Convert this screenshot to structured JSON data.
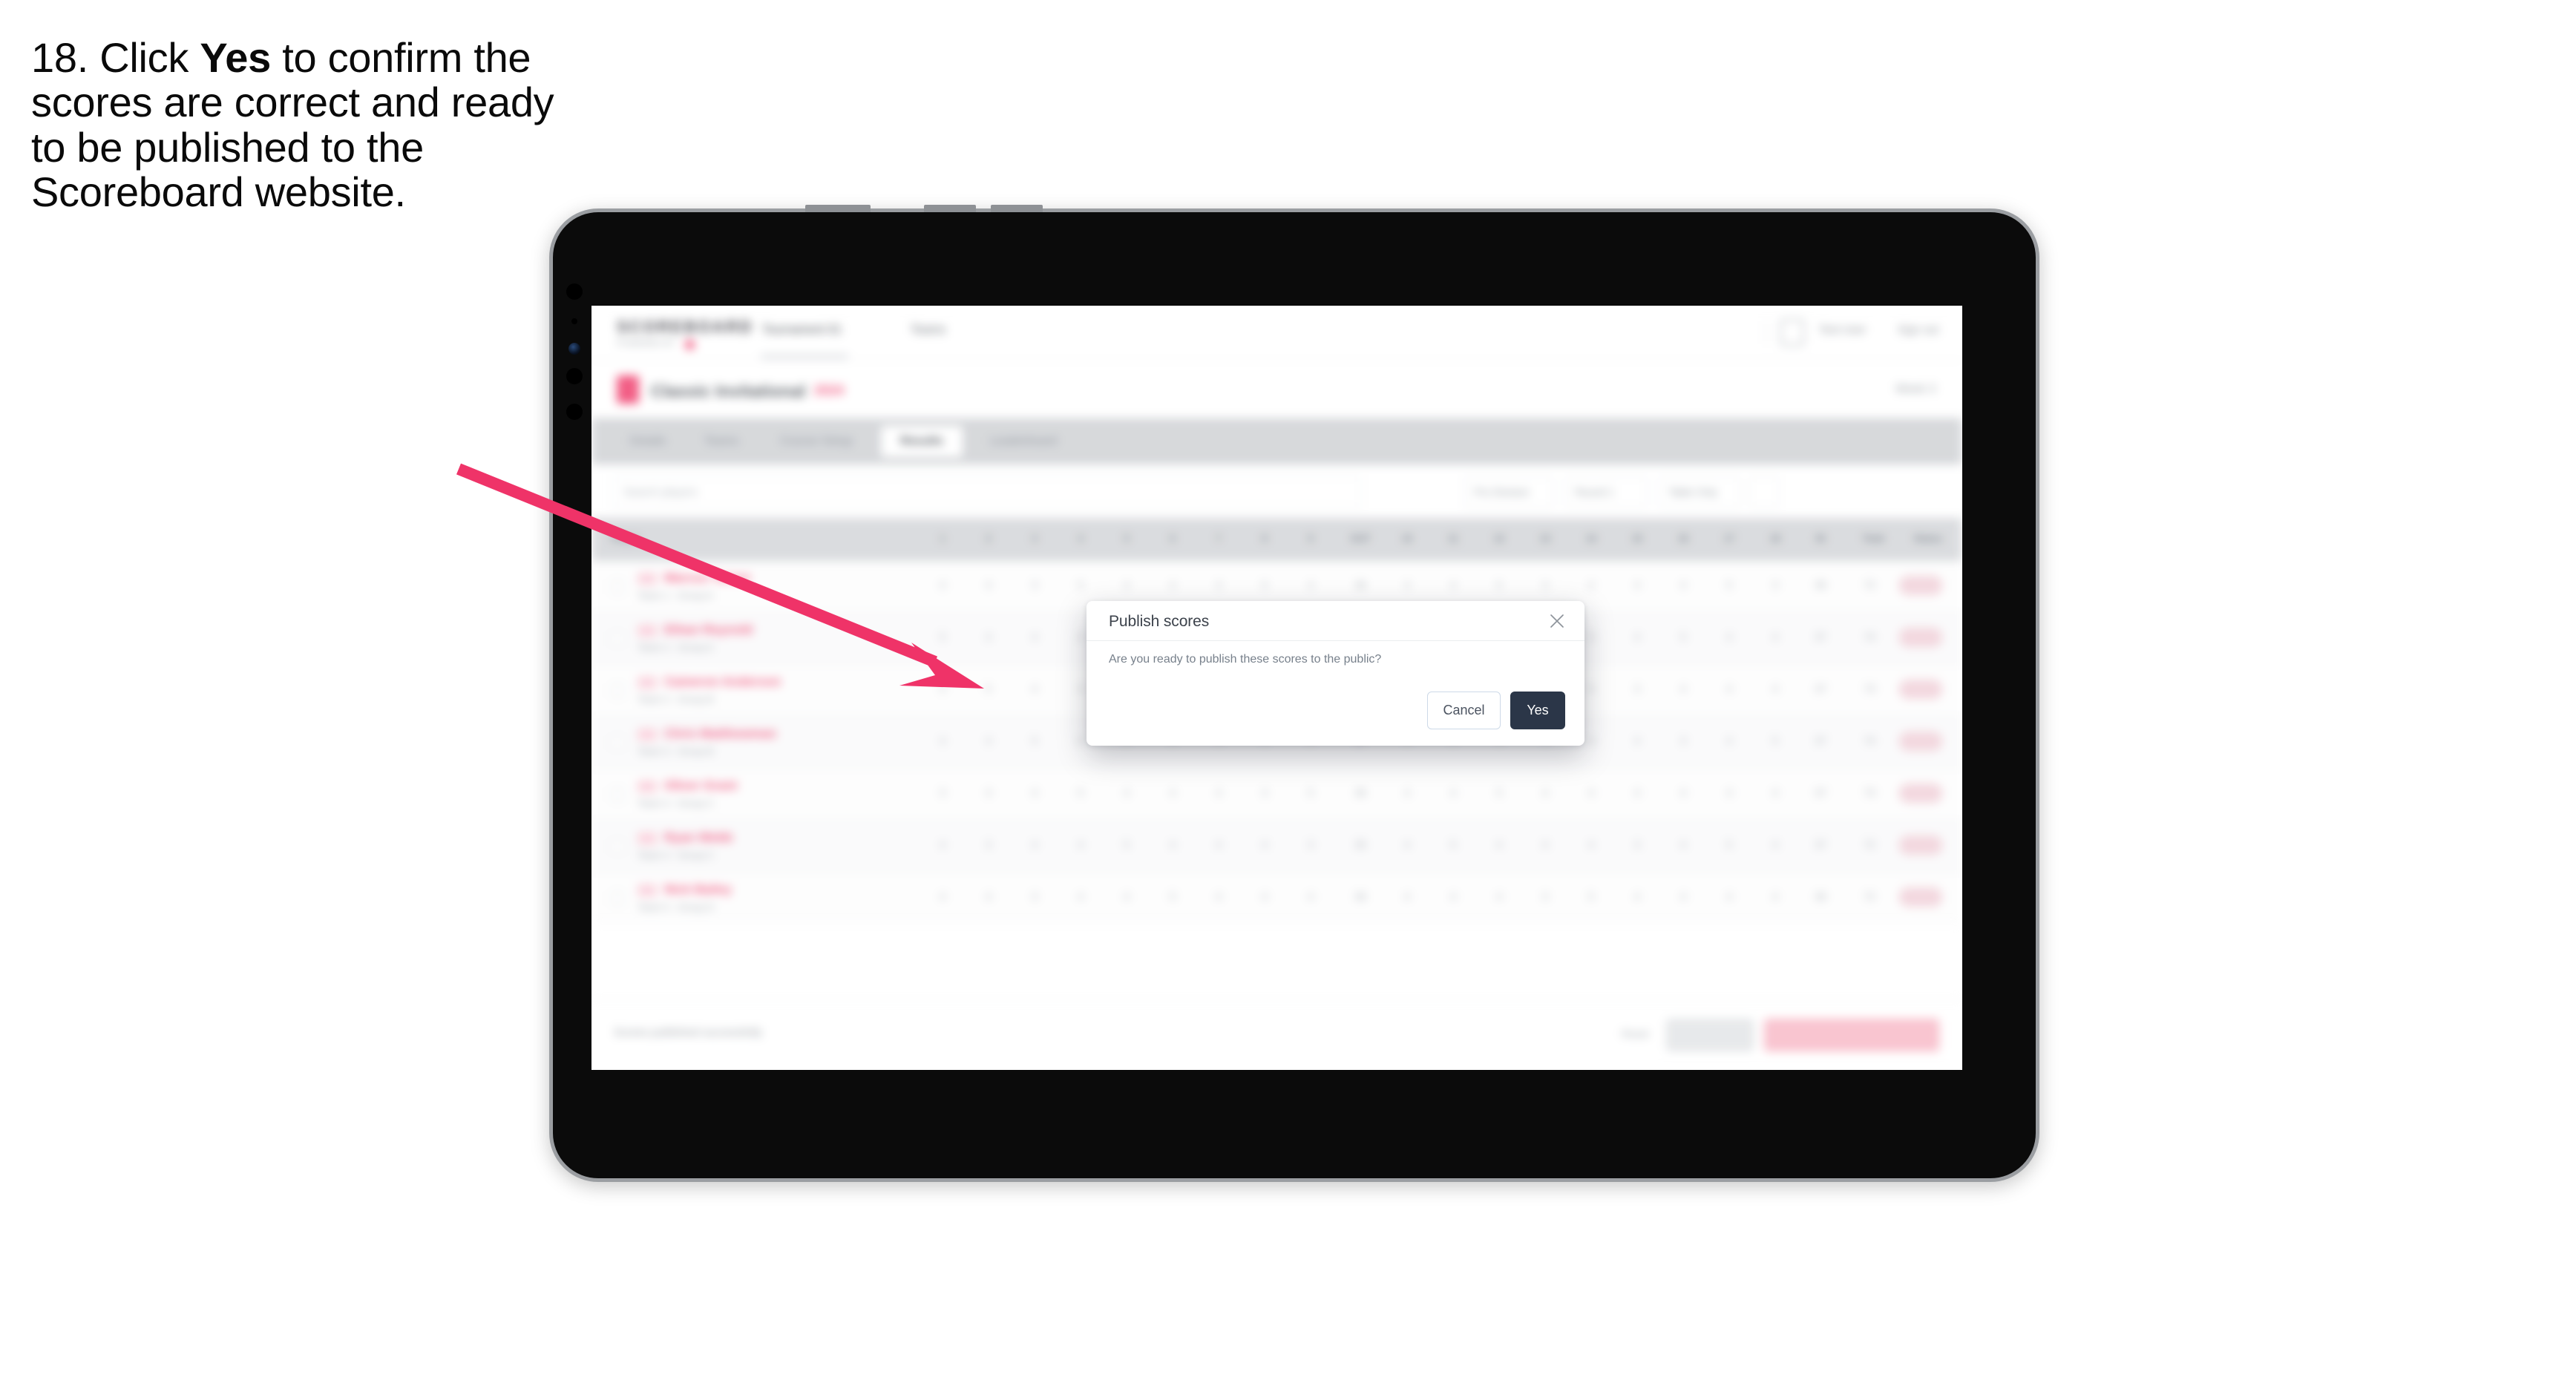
{
  "instruction": {
    "number": "18.",
    "before": "Click ",
    "bold": "Yes",
    "after": " to confirm the scores are correct and ready to be published to the Scoreboard website."
  },
  "colors": {
    "arrow": "#ef3368",
    "accent_pink": "#f2567f",
    "primary_dark": "#2b3648",
    "cancel_border": "#cdd9e8",
    "tab_strip": "#d5d7da",
    "frame_edge": "#9b9ea2",
    "bezel": "#0b0b0b"
  },
  "device": {
    "name": "tablet-device-frame",
    "orientation": "landscape"
  },
  "modal": {
    "name": "publish-scores-dialog",
    "title": "Publish scores",
    "body": "Are you ready to publish these scores to the public?",
    "close_icon": "close-icon",
    "cancel_label": "Cancel",
    "confirm_label": "Yes"
  },
  "app": {
    "brand": "SCOREBOARD",
    "brand_sub": "POWERED BY",
    "nav": [
      {
        "label": "Tournament 01",
        "selected": true
      },
      {
        "label": "Teams",
        "selected": false
      }
    ],
    "user": "Test User",
    "signout": "Sign out",
    "event": {
      "title": "Classic Invitational",
      "year": "2024",
      "right": "Week 3"
    },
    "tabs": [
      {
        "label": "Details",
        "active": false
      },
      {
        "label": "Teams",
        "active": false
      },
      {
        "label": "Course Setup",
        "active": false
      },
      {
        "label": "Results",
        "active": true
      },
      {
        "label": "Leaderboard",
        "active": false
      }
    ],
    "search_placeholder": "Search players",
    "filters": [
      {
        "label": "Pro Division"
      },
      {
        "label": "Round 1"
      },
      {
        "label": "Table Only"
      }
    ],
    "table": {
      "columns": [
        "Player",
        "1",
        "2",
        "3",
        "4",
        "5",
        "6",
        "7",
        "8",
        "9",
        "OUT",
        "10",
        "11",
        "12",
        "13",
        "14",
        "15",
        "16",
        "17",
        "18",
        "IN",
        "Total",
        "Status"
      ],
      "rows": [
        {
          "badge": "PRO",
          "name": "Marcus Turner",
          "sub": "Team 1 - Group A"
        },
        {
          "badge": "PRO",
          "name": "Ethan Reynold",
          "sub": "Team 2 - Group A"
        },
        {
          "badge": "PRO",
          "name": "Cameron Anderson",
          "sub": "Team 2 - Group B"
        },
        {
          "badge": "PRO",
          "name": "Chris Matthewman",
          "sub": "Team 3 - Group B"
        },
        {
          "badge": "PRO",
          "name": "Oliver Grant",
          "sub": "Team 4 - Group C"
        },
        {
          "badge": "PRO",
          "name": "Ryan Webb",
          "sub": "Team 4 - Group C"
        },
        {
          "badge": "PRO",
          "name": "Nick Bailey",
          "sub": "Team 5 - Group D"
        }
      ]
    },
    "footer": {
      "note": "Scores published successfully",
      "link": "Reset",
      "button_gray": "Save",
      "button_pink": "Publish and Send Scores"
    }
  }
}
